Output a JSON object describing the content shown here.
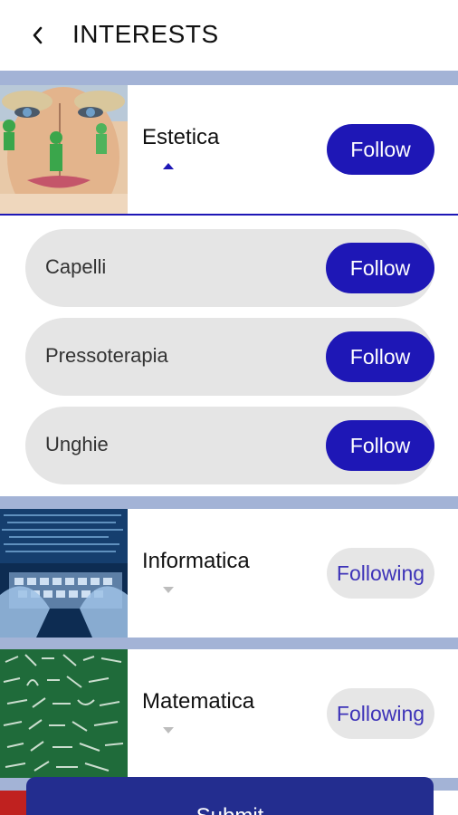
{
  "header": {
    "title": "INTERESTS",
    "back_icon": "chevron-left-icon"
  },
  "categories": [
    {
      "name": "Estetica",
      "button": "Follow",
      "state": "follow",
      "expanded": true,
      "caret": "caret-up-icon",
      "subcategories": [
        {
          "name": "Capelli",
          "button": "Follow"
        },
        {
          "name": "Pressoterapia",
          "button": "Follow"
        },
        {
          "name": "Unghie",
          "button": "Follow"
        }
      ]
    },
    {
      "name": "Informatica",
      "button": "Following",
      "state": "following",
      "expanded": false,
      "caret": "caret-down-icon"
    },
    {
      "name": "Matematica",
      "button": "Following",
      "state": "following",
      "expanded": false,
      "caret": "caret-down-icon"
    }
  ],
  "footer": {
    "submit_label": "Submit"
  },
  "colors": {
    "accent": "#1e17b6",
    "separator": "#a3b3d6",
    "pill_bg": "#e5e5e5",
    "following_text": "#3d33b8",
    "submit_bg": "#232d8f"
  }
}
